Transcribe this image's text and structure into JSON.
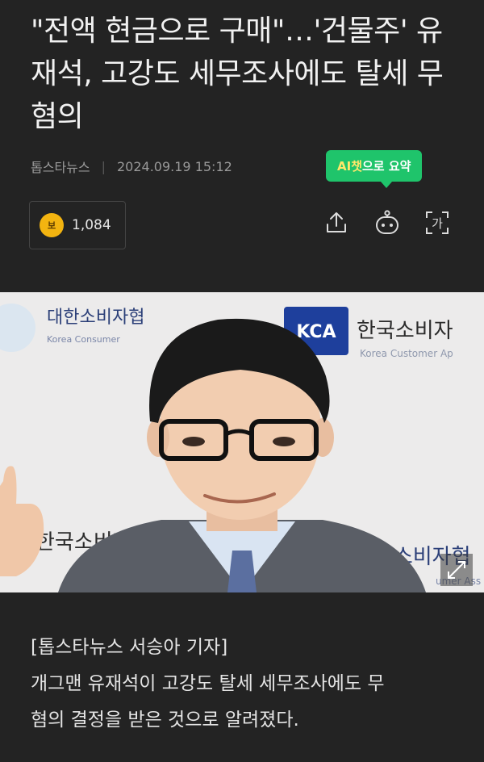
{
  "article": {
    "headline": "\"전액 현금으로 구매\"…'건물주' 유재석, 고강도 세무조사에도 탈세 무혐의",
    "source": "톱스타뉴스",
    "datetime": "2024.09.19 15:12",
    "body_lines": [
      "[톱스타뉴스 서승아 기자]",
      "개그맨 유재석이 고강도 탈세 세무조사에도 무",
      "혐의 결정을 받은 것으로 알려졌다."
    ]
  },
  "ai_summary": {
    "highlight": "AI챗",
    "rest": "으로 요약"
  },
  "reactions": {
    "coin_glyph": "보",
    "count": "1,084"
  },
  "toolbar": {
    "icons": [
      "share-icon",
      "chatbot-icon",
      "font-size-icon"
    ],
    "font_glyph": "가"
  },
  "photo": {
    "backdrop_texts": [
      "대한소비자협",
      "Korea Consumer",
      "한국소비자",
      "Korea Customer Ap",
      "KCA",
      "한국소비자",
      "대한소비자협",
      "umer Ass"
    ],
    "expand_icon": "expand-icon"
  },
  "colors": {
    "background": "#232323",
    "accent_green": "#1fc46b",
    "coin_gold": "#f3b410"
  }
}
